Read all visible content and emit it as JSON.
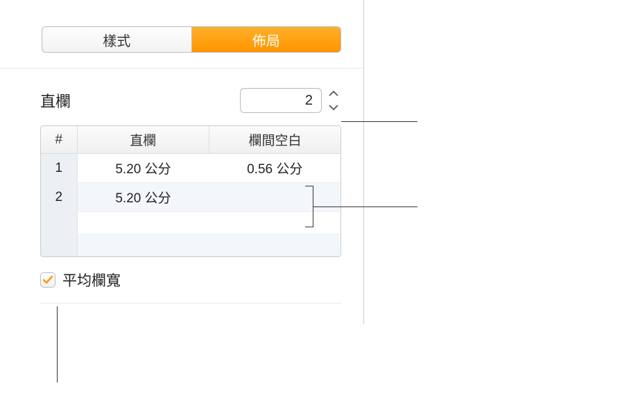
{
  "tabs": {
    "style": "樣式",
    "layout": "佈局"
  },
  "columns": {
    "label": "直欄",
    "value": "2"
  },
  "table": {
    "headers": {
      "num": "#",
      "col": "直欄",
      "gutter": "欄間空白"
    },
    "rows": [
      {
        "num": "1",
        "col": "5.20 公分",
        "gutter": "0.56 公分"
      },
      {
        "num": "2",
        "col": "5.20 公分",
        "gutter": ""
      }
    ]
  },
  "equalWidth": {
    "label": "平均欄寬",
    "checked": true
  },
  "colors": {
    "accent": "#ff9500"
  }
}
